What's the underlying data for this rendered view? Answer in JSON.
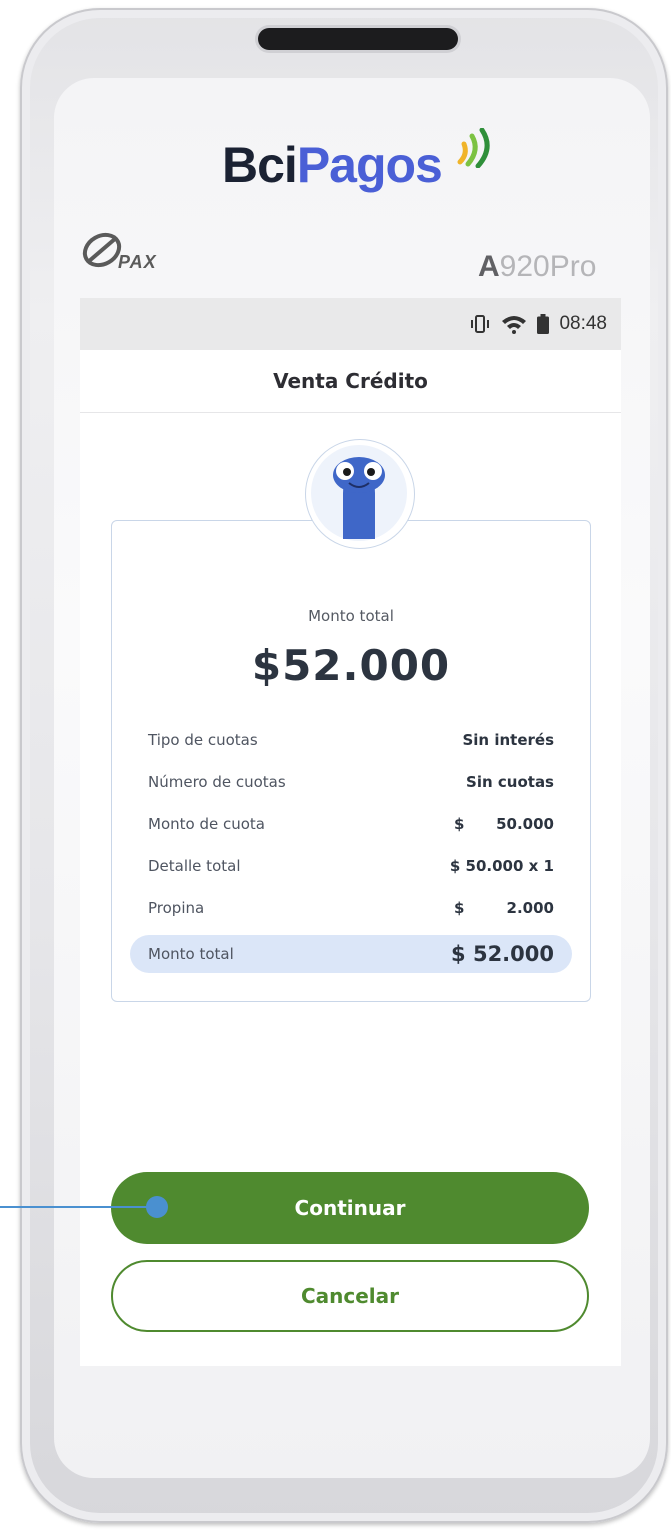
{
  "device": {
    "brand_part1": "Bci",
    "brand_part2": "Pagos",
    "maker": "PAX",
    "model_prefix": "A",
    "model_suffix": "920Pro"
  },
  "status_bar": {
    "time": "08:48",
    "icons": [
      "vibrate-icon",
      "wifi-icon",
      "battery-icon"
    ]
  },
  "header": {
    "title": "Venta Crédito"
  },
  "summary": {
    "total_label": "Monto total",
    "total_amount": "$52.000",
    "rows": [
      {
        "label": "Tipo de cuotas",
        "currency": "",
        "value": "Sin interés"
      },
      {
        "label": "Número de cuotas",
        "currency": "",
        "value": "Sin cuotas"
      },
      {
        "label": "Monto de cuota",
        "currency": "$",
        "value": "50.000"
      },
      {
        "label": "Detalle total",
        "currency": "",
        "value": "$ 50.000 x 1"
      },
      {
        "label": "Propina",
        "currency": "$",
        "value": "2.000"
      }
    ],
    "highlight": {
      "label": "Monto total",
      "value": "$ 52.000"
    }
  },
  "actions": {
    "continue_label": "Continuar",
    "cancel_label": "Cancelar"
  },
  "colors": {
    "primary_green": "#4f8a2f",
    "highlight_blue": "#dbe6f8",
    "pointer_blue": "#4a90d0",
    "brand_blue": "#4a5fd6"
  }
}
